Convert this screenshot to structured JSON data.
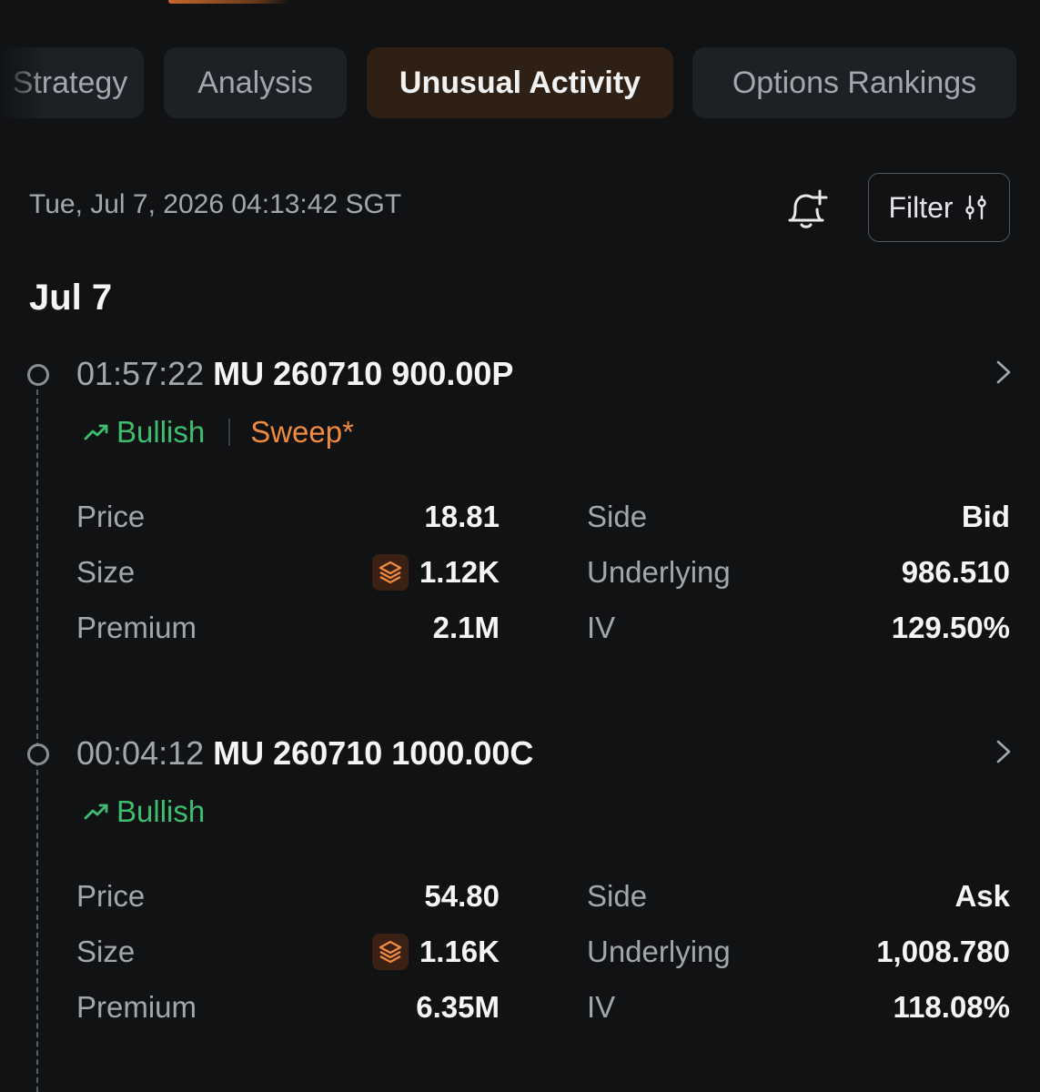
{
  "tabs": [
    {
      "label": "Strategy",
      "active": false
    },
    {
      "label": "Analysis",
      "active": false
    },
    {
      "label": "Unusual Activity",
      "active": true
    },
    {
      "label": "Options Rankings",
      "active": false
    }
  ],
  "header": {
    "timestamp": "Tue, Jul 7, 2026 04:13:42 SGT",
    "filter_label": "Filter"
  },
  "date_heading": "Jul 7",
  "entries": [
    {
      "time": "01:57:22",
      "contract": "MU 260710 900.00P",
      "sentiment": "Bullish",
      "tag": "Sweep*",
      "price_label": "Price",
      "price": "18.81",
      "size_label": "Size",
      "size": "1.12K",
      "premium_label": "Premium",
      "premium": "2.1M",
      "side_label": "Side",
      "side": "Bid",
      "underlying_label": "Underlying",
      "underlying": "986.510",
      "iv_label": "IV",
      "iv": "129.50%"
    },
    {
      "time": "00:04:12",
      "contract": "MU 260710 1000.00C",
      "sentiment": "Bullish",
      "price_label": "Price",
      "price": "54.80",
      "size_label": "Size",
      "size": "1.16K",
      "premium_label": "Premium",
      "premium": "6.35M",
      "side_label": "Side",
      "side": "Ask",
      "underlying_label": "Underlying",
      "underlying": "1,008.780",
      "iv_label": "IV",
      "iv": "118.08%"
    }
  ],
  "colors": {
    "background": "#101214",
    "accent": "#f08a3c",
    "bullish": "#3ebd6f",
    "active_tab_bg": "#2e2015"
  },
  "icons": [
    "bell-plus-icon",
    "sliders-icon",
    "chevron-right-icon",
    "trend-up-icon",
    "layers-icon"
  ]
}
